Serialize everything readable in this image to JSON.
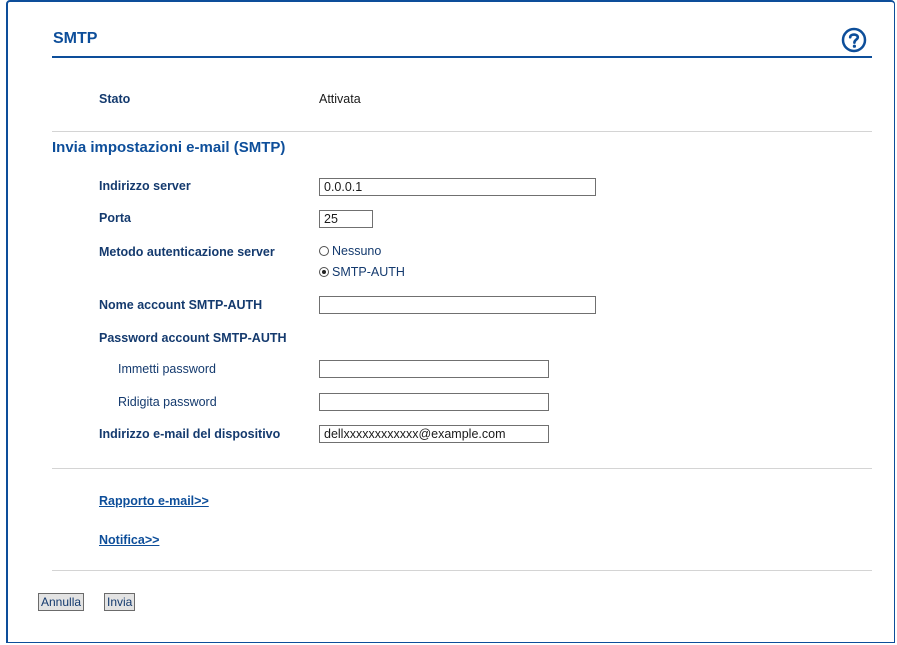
{
  "page": {
    "title": "SMTP"
  },
  "status": {
    "label": "Stato",
    "value": "Attivata"
  },
  "section": {
    "heading": "Invia impostazioni e-mail (SMTP)"
  },
  "form": {
    "server_address": {
      "label": "Indirizzo server",
      "value": "0.0.0.1"
    },
    "port": {
      "label": "Porta",
      "value": "25"
    },
    "auth_method": {
      "label": "Metodo autenticazione server",
      "options": [
        {
          "label": "Nessuno",
          "selected": false
        },
        {
          "label": "SMTP-AUTH",
          "selected": true
        }
      ]
    },
    "account_name": {
      "label": "Nome account SMTP-AUTH",
      "value": ""
    },
    "account_password": {
      "label": "Password account SMTP-AUTH",
      "enter_label": "Immetti password",
      "enter_value": "",
      "retype_label": "Ridigita password",
      "retype_value": ""
    },
    "device_email": {
      "label": "Indirizzo e-mail del dispositivo",
      "value": "dellxxxxxxxxxxxx@example.com"
    }
  },
  "links": {
    "email_report": "Rapporto e-mail>>",
    "notification": "Notifica>>"
  },
  "buttons": {
    "cancel": "Annulla",
    "submit": "Invia"
  },
  "colors": {
    "accent": "#0d4e9a",
    "label_text": "#143a6e",
    "divider": "#d4d4d4"
  },
  "icons": {
    "help": "help-question-icon"
  }
}
